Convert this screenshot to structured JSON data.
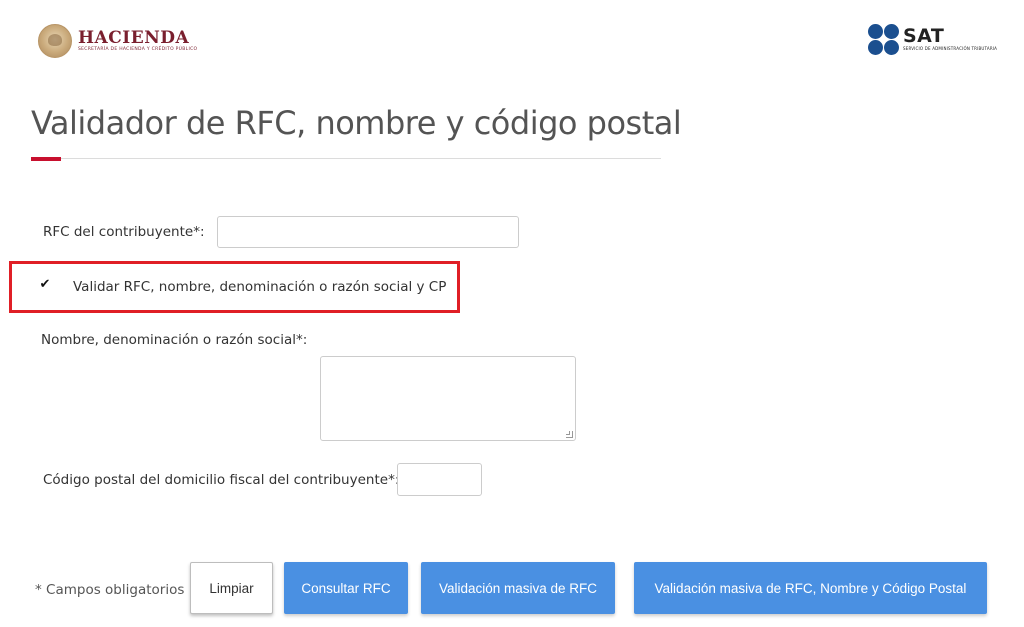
{
  "header": {
    "left_logo": {
      "title": "HACIENDA",
      "subtitle": "SECRETARÍA DE HACIENDA Y CRÉDITO PÚBLICO"
    },
    "right_logo": {
      "title": "SAT",
      "subtitle": "SERVICIO DE ADMINISTRACIÓN TRIBUTARIA"
    }
  },
  "page": {
    "title": "Validador de RFC, nombre y código postal"
  },
  "form": {
    "rfc_label": "RFC del contribuyente*:",
    "rfc_value": "",
    "validate_checkbox": {
      "label": "Validar RFC, nombre, denominación o razón social y CP",
      "checked": true,
      "glyph": "✔"
    },
    "nombre_label": "Nombre, denominación o razón social*:",
    "nombre_value": "",
    "cp_label": "Código postal del domicilio fiscal del contribuyente*:",
    "cp_value": ""
  },
  "footer": {
    "required_note": "* Campos obligatorios",
    "buttons": {
      "limpiar": "Limpiar",
      "consultar": "Consultar RFC",
      "masiva": "Validación masiva de RFC",
      "masiva_cp": "Validación masiva de RFC, Nombre y Código Postal"
    }
  },
  "colors": {
    "accent_red": "#c8102e",
    "highlight_red": "#e01f26",
    "primary_blue": "#4a90e2",
    "sat_blue": "#1b4f8f",
    "hacienda_maroon": "#7a1f2e"
  }
}
